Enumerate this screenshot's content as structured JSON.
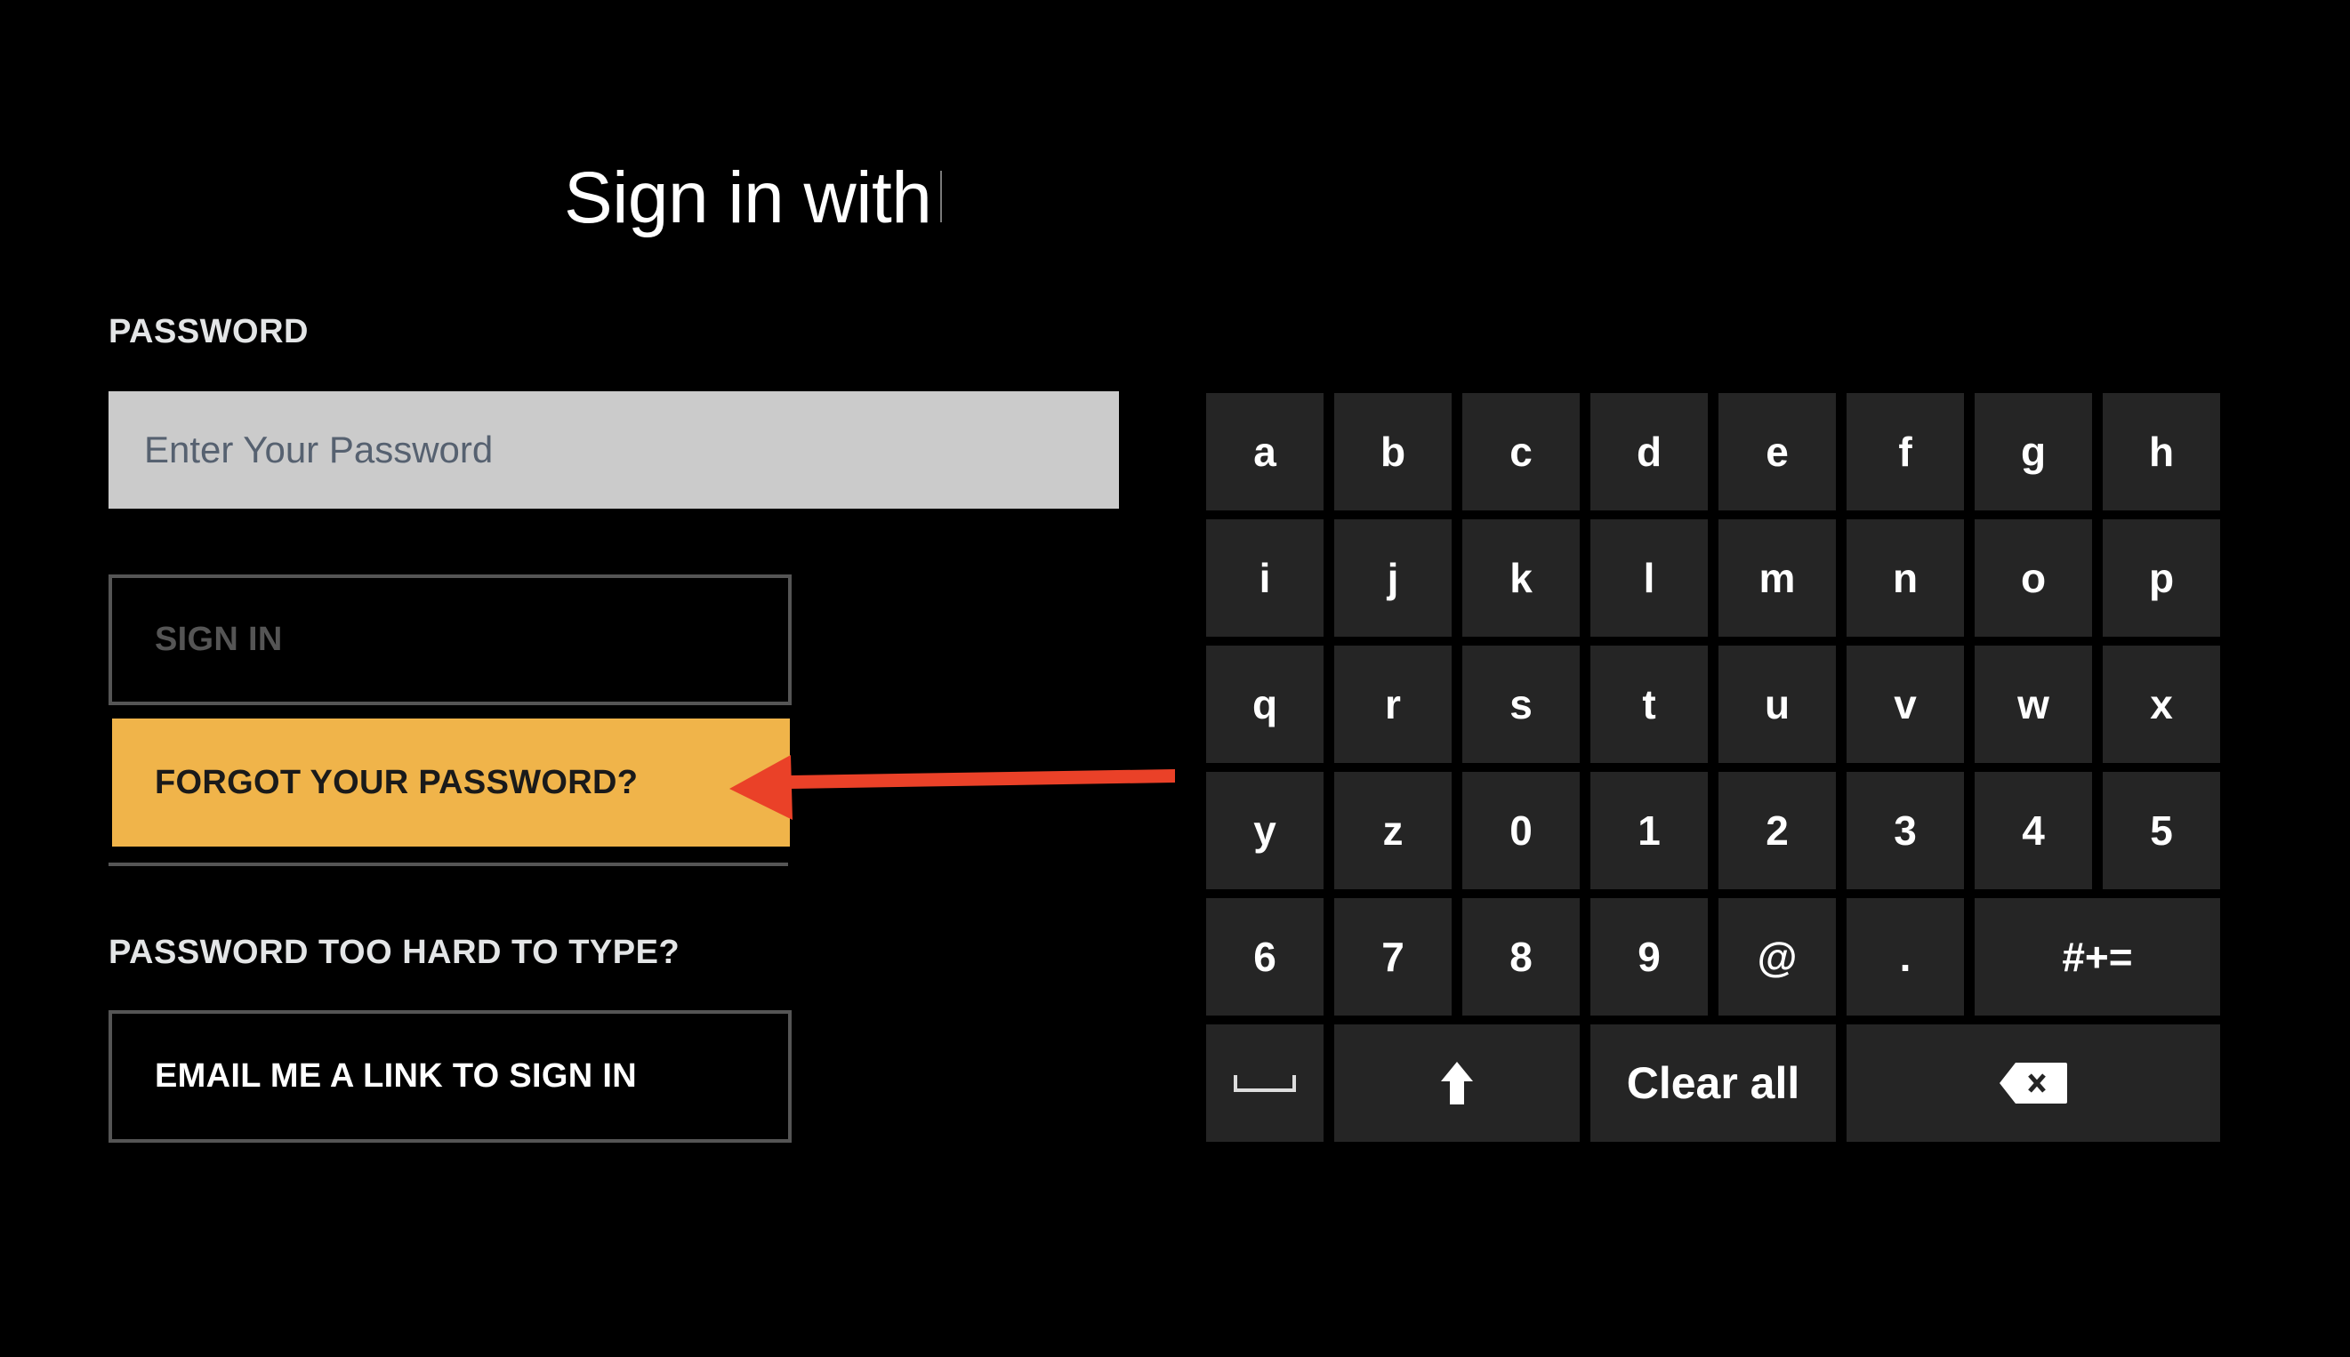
{
  "header": {
    "title": "Sign in with"
  },
  "form": {
    "password_label": "PASSWORD",
    "password_input": {
      "value": "",
      "placeholder": "Enter Your Password"
    },
    "sign_in_label": "SIGN IN",
    "forgot_label": "FORGOT YOUR PASSWORD?",
    "too_hard_label": "PASSWORD TOO HARD TO TYPE?",
    "email_link_label": "EMAIL ME A LINK TO SIGN IN"
  },
  "annotation": {
    "arrow_color": "#ea4128",
    "points_to": "forgot-password-button"
  },
  "colors": {
    "accent": "#f0b44a",
    "key_bg": "#252525",
    "input_bg": "#cbcbcb",
    "border": "#555555"
  },
  "keyboard": {
    "rows": [
      [
        {
          "label": "a"
        },
        {
          "label": "b"
        },
        {
          "label": "c"
        },
        {
          "label": "d"
        },
        {
          "label": "e"
        },
        {
          "label": "f"
        },
        {
          "label": "g"
        },
        {
          "label": "h"
        }
      ],
      [
        {
          "label": "i"
        },
        {
          "label": "j"
        },
        {
          "label": "k"
        },
        {
          "label": "l"
        },
        {
          "label": "m"
        },
        {
          "label": "n"
        },
        {
          "label": "o"
        },
        {
          "label": "p"
        }
      ],
      [
        {
          "label": "q"
        },
        {
          "label": "r"
        },
        {
          "label": "s"
        },
        {
          "label": "t"
        },
        {
          "label": "u"
        },
        {
          "label": "v"
        },
        {
          "label": "w"
        },
        {
          "label": "x"
        }
      ],
      [
        {
          "label": "y"
        },
        {
          "label": "z"
        },
        {
          "label": "0"
        },
        {
          "label": "1"
        },
        {
          "label": "2"
        },
        {
          "label": "3"
        },
        {
          "label": "4"
        },
        {
          "label": "5"
        }
      ],
      [
        {
          "label": "6"
        },
        {
          "label": "7"
        },
        {
          "label": "8"
        },
        {
          "label": "9"
        },
        {
          "label": "@"
        },
        {
          "label": "."
        },
        {
          "label": "#+=",
          "span": 2,
          "name": "symbols-key"
        }
      ],
      [
        {
          "icon": "space-icon",
          "span": 1,
          "name": "space-key"
        },
        {
          "icon": "shift-icon",
          "span": 2,
          "name": "shift-key"
        },
        {
          "label": "Clear all",
          "span": 2,
          "name": "clear-all-key"
        },
        {
          "icon": "backspace-icon",
          "span": 3,
          "name": "backspace-key"
        }
      ]
    ]
  }
}
